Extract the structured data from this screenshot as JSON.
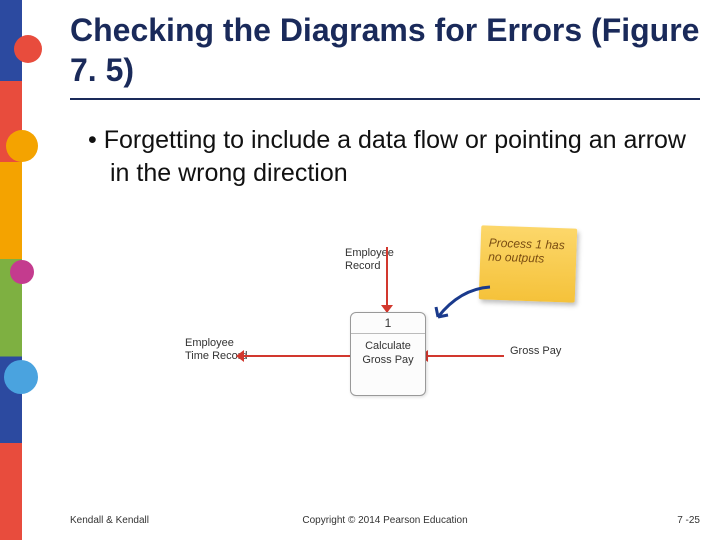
{
  "title": "Checking the Diagrams for Errors (Figure 7. 5)",
  "bullet": "Forgetting to include a data flow or pointing an arrow in the wrong direction",
  "diagram": {
    "process": {
      "number": "1",
      "name": "Calculate Gross Pay"
    },
    "flows": {
      "top": "Employee Record",
      "left": "Employee Time Record",
      "right": "Gross Pay"
    },
    "note": "Process 1 has no outputs"
  },
  "footer": {
    "left": "Kendall & Kendall",
    "center": "Copyright © 2014 Pearson Education",
    "right": "7 -25"
  }
}
